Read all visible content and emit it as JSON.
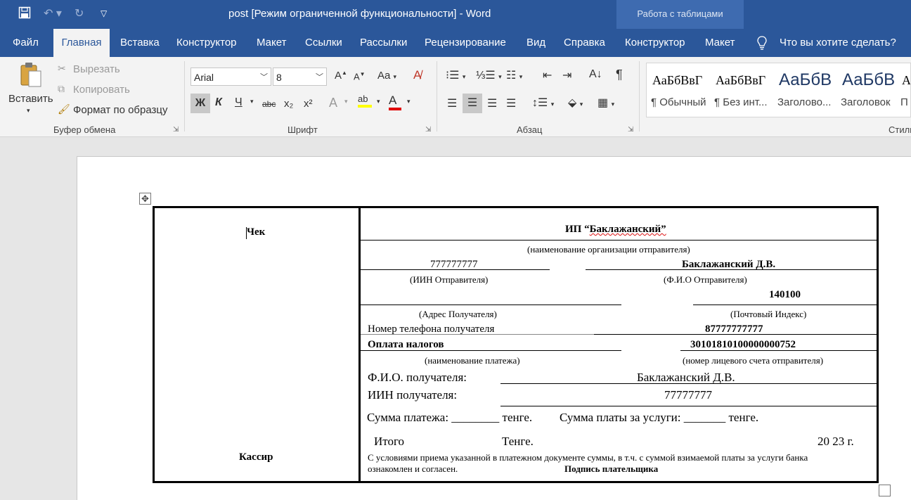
{
  "window": {
    "title": "post [Режим ограниченной функциональности]  -  Word",
    "context_tab_title": "Работа с таблицами"
  },
  "qat": {
    "save_icon": "save-icon",
    "undo_icon": "undo-icon",
    "redo_icon": "redo-icon",
    "customize_icon": "chevron-down-icon"
  },
  "tabs": {
    "file": "Файл",
    "home": "Главная",
    "insert": "Вставка",
    "design": "Конструктор",
    "layout": "Макет",
    "references": "Ссылки",
    "mailings": "Рассылки",
    "review": "Рецензирование",
    "view": "Вид",
    "help": "Справка",
    "table_design": "Конструктор",
    "table_layout": "Макет",
    "tell_me": "Что вы хотите сделать?"
  },
  "clipboard": {
    "paste": "Вставить",
    "cut": "Вырезать",
    "copy": "Копировать",
    "format_painter": "Формат по образцу",
    "label": "Буфер обмена"
  },
  "font": {
    "name": "Arial",
    "size": "8",
    "bold": "Ж",
    "italic": "К",
    "underline": "Ч",
    "strike": "abc",
    "subscript": "x₂",
    "superscript": "x²",
    "change_case": "Aa",
    "grow": "A",
    "shrink": "A",
    "label": "Шрифт"
  },
  "paragraph": {
    "label": "Абзац"
  },
  "styles": {
    "items": [
      {
        "preview": "АаБбВвГ",
        "name": "¶ Обычный"
      },
      {
        "preview": "АаБбВвГ",
        "name": "¶ Без инт..."
      },
      {
        "preview": "АаБбВ",
        "name": "Заголово..."
      },
      {
        "preview": "АаБбВ",
        "name": "Заголовок"
      },
      {
        "preview": "Аа",
        "name": "П"
      }
    ],
    "label": "Стили"
  },
  "document": {
    "left_title": "Чек",
    "left_footer": "Кассир",
    "org_name": "ИП “Баклажанский”",
    "org_caption": "(наименование организации отправителя)",
    "iin_value": "777777777",
    "sender_name": "Баклажанский Д.В.",
    "iin_caption": "(ИИН Отправителя)",
    "sender_caption": "(Ф.И.О Отправителя)",
    "postcode_value": "140100",
    "address_caption": "(Адрес Получателя)",
    "postcode_caption": "(Почтовый Индекс)",
    "phone_label": "Номер телефона получателя",
    "phone_value": "87777777777",
    "payment_name": "Оплата налогов",
    "account_value": "30101810100000000752",
    "payment_caption": "(наименование платежа)",
    "account_caption": "(номер лицевого счета отправителя)",
    "recipient_label": "Ф.И.О. получателя:",
    "recipient_value": "Баклажанский Д.В.",
    "recipient_iin_label": "ИИН получателя:",
    "recipient_iin_value": "77777777",
    "sum_text": "Сумма платежа: ________ тенге.",
    "fee_text": "Сумма платы за услуги: _______ тенге.",
    "total_label": "Итого",
    "tenge_label": "Тенге.",
    "year_text": "20 23 г.",
    "terms_line1": "С условиями приема указанной в платежном документе суммы, в т.ч. с суммой взимаемой платы за услуги банка",
    "terms_line2": "ознакомлен и согласен.",
    "signature_label": "Подпись плательщика"
  }
}
